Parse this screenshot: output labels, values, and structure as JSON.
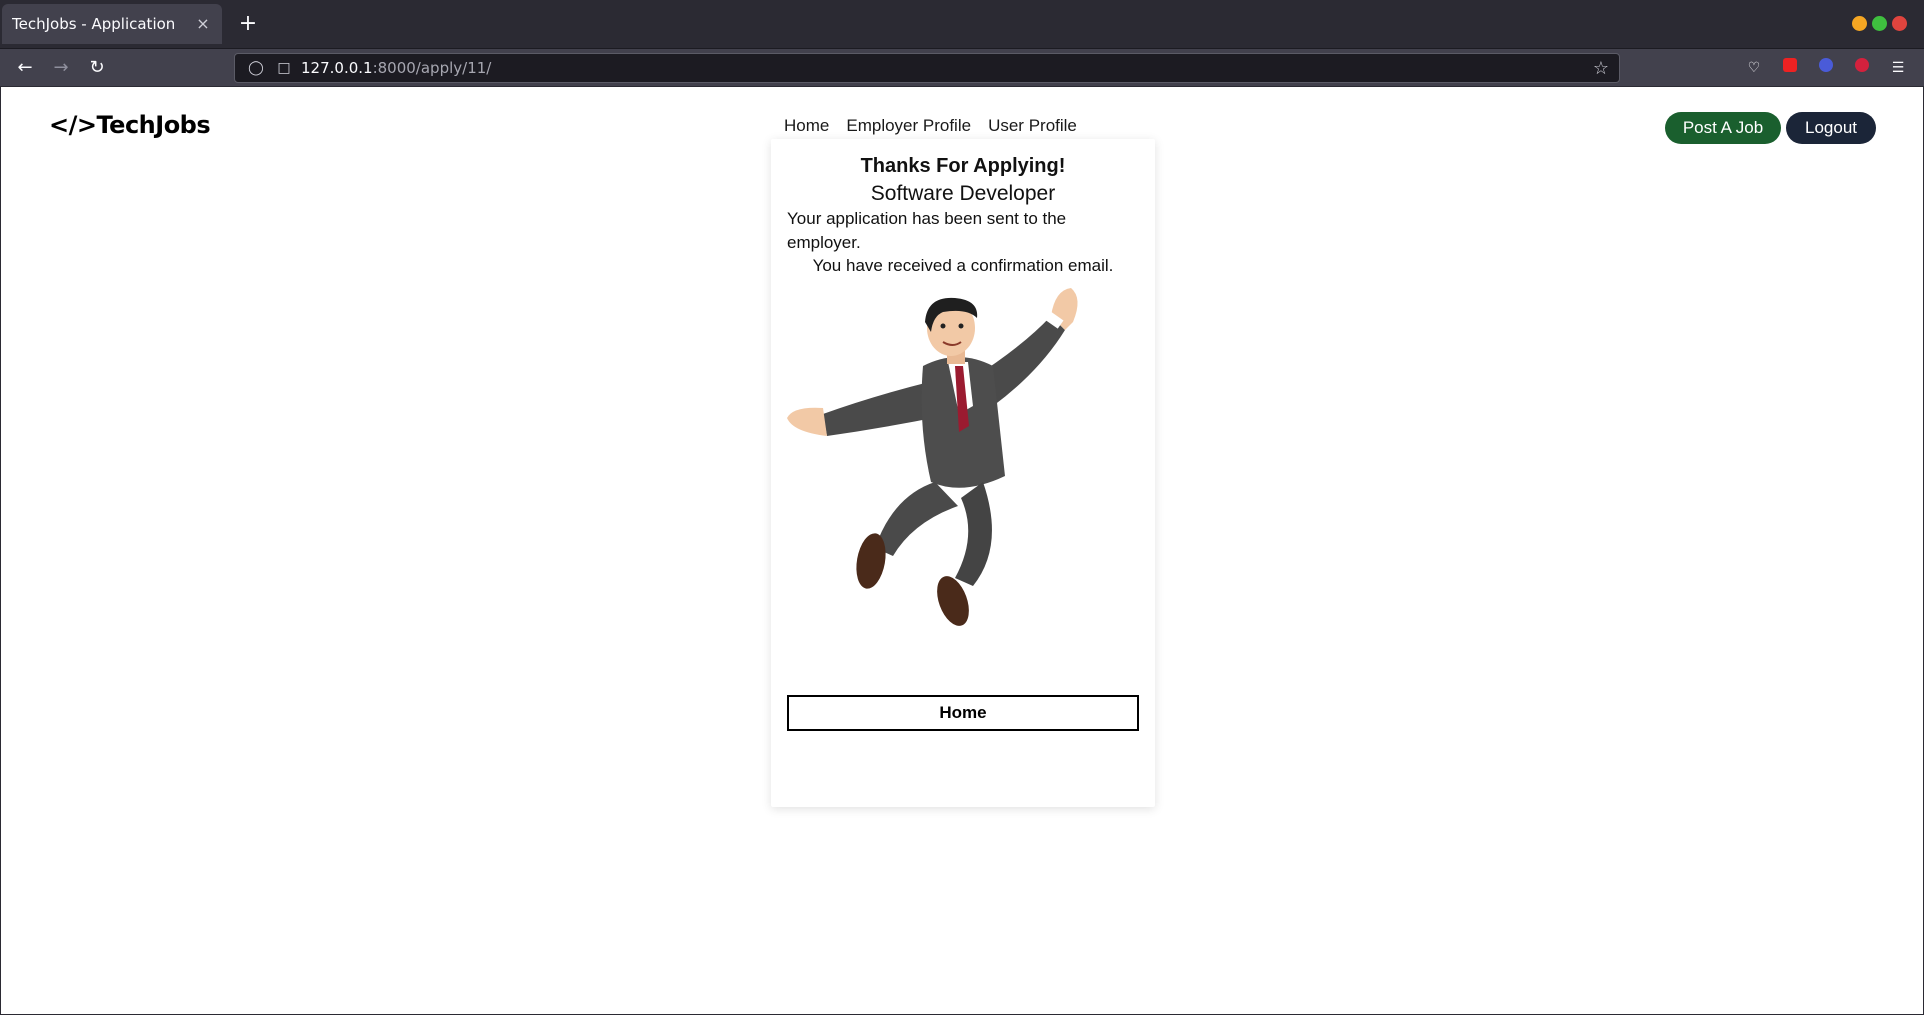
{
  "browser": {
    "tab_title": "TechJobs - Application",
    "tab_close": "×",
    "new_tab": "+",
    "url_host": "127.0.0.1",
    "url_path": ":8000/apply/11/"
  },
  "site": {
    "logo": "</>TechJobs",
    "nav": {
      "home": "Home",
      "employer_profile": "Employer Profile",
      "user_profile": "User Profile"
    },
    "post_job": "Post A Job",
    "logout": "Logout"
  },
  "confirmation": {
    "heading": "Thanks For Applying!",
    "job_title": "Software Developer",
    "message_1": "Your application has been sent to the employer.",
    "message_2": "You have received a confirmation email.",
    "home_button": "Home"
  },
  "colors": {
    "post_job_bg": "#1a5f2e",
    "logout_bg": "#1b2538",
    "tie": "#9b1b30",
    "suit": "#4a4a4a"
  }
}
